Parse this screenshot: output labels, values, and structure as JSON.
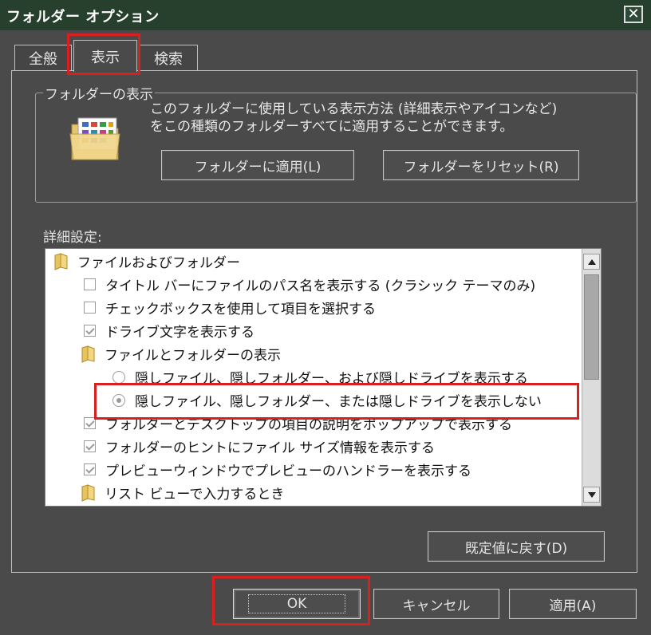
{
  "window": {
    "title": "フォルダー オプション",
    "close_glyph": "✕"
  },
  "tabs": [
    {
      "label": "全般"
    },
    {
      "label": "表示"
    },
    {
      "label": "検索"
    }
  ],
  "folder_views": {
    "legend": "フォルダーの表示",
    "description_line1": "このフォルダーに使用している表示方法 (詳細表示やアイコンなど)",
    "description_line2": "をこの種類のフォルダーすべてに適用することができます。",
    "apply_button": "フォルダーに適用(L)",
    "reset_button": "フォルダーをリセット(R)"
  },
  "advanced": {
    "label": "詳細設定:",
    "items": [
      {
        "type": "folder",
        "label": "ファイルおよびフォルダー"
      },
      {
        "type": "checkbox",
        "checked": false,
        "label": "タイトル バーにファイルのパス名を表示する (クラシック テーマのみ)"
      },
      {
        "type": "checkbox",
        "checked": false,
        "label": "チェックボックスを使用して項目を選択する"
      },
      {
        "type": "checkbox",
        "checked": true,
        "label": "ドライブ文字を表示する"
      },
      {
        "type": "folder",
        "label": "ファイルとフォルダーの表示"
      },
      {
        "type": "radio",
        "checked": false,
        "label": "隠しファイル、隠しフォルダー、および隠しドライブを表示する"
      },
      {
        "type": "radio",
        "checked": true,
        "label": "隠しファイル、隠しフォルダー、または隠しドライブを表示しない"
      },
      {
        "type": "checkbox",
        "checked": true,
        "label": "フォルダーとデスクトップの項目の説明をポップアップで表示する"
      },
      {
        "type": "checkbox",
        "checked": true,
        "label": "フォルダーのヒントにファイル サイズ情報を表示する"
      },
      {
        "type": "checkbox",
        "checked": true,
        "label": "プレビューウィンドウでプレビューのハンドラーを表示する"
      },
      {
        "type": "folder",
        "label": "リスト ビューで入力するとき"
      }
    ],
    "restore_defaults": "既定値に戻す(D)"
  },
  "footer": {
    "ok": "OK",
    "cancel": "キャンセル",
    "apply": "適用(A)"
  },
  "colors": {
    "highlight": "#d9201f",
    "titlebar": "#27402e",
    "background": "#4a4a4a"
  }
}
